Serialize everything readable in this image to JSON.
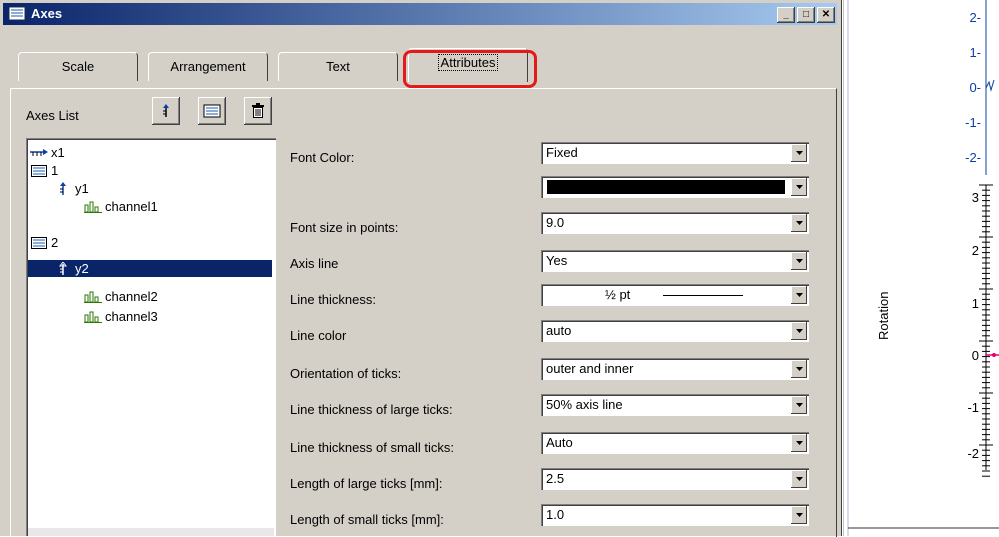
{
  "window": {
    "title": "Axes"
  },
  "tabs": [
    {
      "label": "Scale"
    },
    {
      "label": "Arrangement"
    },
    {
      "label": "Text"
    },
    {
      "label": "Attributes"
    }
  ],
  "axes_list": {
    "label": "Axes List",
    "items": [
      {
        "label": "x1"
      },
      {
        "label": "1"
      },
      {
        "label": "y1"
      },
      {
        "label": "channel1"
      },
      {
        "label": "2"
      },
      {
        "label": "y2"
      },
      {
        "label": "channel2"
      },
      {
        "label": "channel3"
      }
    ]
  },
  "properties": [
    {
      "label": "Font Color:",
      "value": "Fixed"
    },
    {
      "label": "",
      "value": ""
    },
    {
      "label": "Font size in points:",
      "value": "9.0"
    },
    {
      "label": "Axis line",
      "value": "Yes"
    },
    {
      "label": "Line thickness:",
      "value": "½ pt"
    },
    {
      "label": "Line color",
      "value": "auto"
    },
    {
      "label": "Orientation of ticks:",
      "value": "outer and inner"
    },
    {
      "label": "Line thickness of large ticks:",
      "value": "50% axis line"
    },
    {
      "label": "Line thickness of small ticks:",
      "value": "Auto"
    },
    {
      "label": "Length of large ticks [mm]:",
      "value": "2.5"
    },
    {
      "label": "Length of small ticks [mm]:",
      "value": "1.0"
    }
  ],
  "background_chart": {
    "upper_ticks": [
      "2-",
      "1-",
      "0-",
      "-1-",
      "-2-"
    ],
    "lower_ticks": [
      "3",
      "2",
      "1",
      "0",
      "-1",
      "-2"
    ],
    "axis_title": "Rotation"
  },
  "colors": {
    "selection": "#0a246a",
    "highlight": "#e21a1a",
    "trace": "#e6006e"
  }
}
